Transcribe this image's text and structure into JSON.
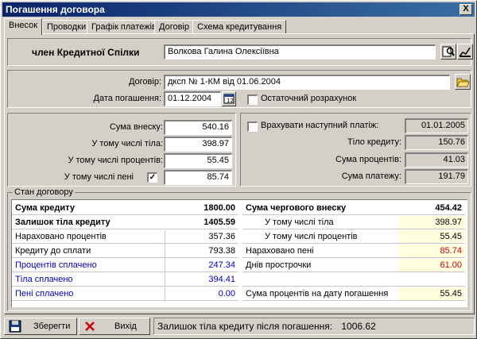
{
  "window": {
    "title": "Погашення договора",
    "close_label": "X"
  },
  "tabs": [
    "Внесок",
    "Проводки",
    "Графік платежів",
    "Договір",
    "Схема кредитування"
  ],
  "member": {
    "label": "член Кредитної Спілки",
    "name": "Волкова Галина Олексіївна"
  },
  "contract": {
    "contract_label": "Договір:",
    "contract_value": "дксп № 1-КМ від 01.06.2004",
    "date_label": "Дата погашення:",
    "date_value": "01.12.2004",
    "final_calc_label": "Остаточний розрахунок"
  },
  "payment": {
    "sum_label": "Сума внеску:",
    "sum_value": "540.16",
    "body_label": "У тому числі тіла:",
    "body_value": "398.97",
    "interest_label": "У тому числі процентів:",
    "interest_value": "55.45",
    "penalty_label": "У тому числі пені",
    "penalty_value": "85.74",
    "penalty_checked": "✓"
  },
  "next_payment": {
    "include_label": "Врахувати наступний платіж:",
    "date_value": "01.01.2005",
    "body_label": "Тіло кредиту:",
    "body_value": "150.76",
    "interest_label": "Сума процентів:",
    "interest_value": "41.03",
    "total_label": "Сума платежу:",
    "total_value": "191.79"
  },
  "state": {
    "title": "Стан договору",
    "left_rows": [
      {
        "label": "Сума кредиту",
        "value": "1800.00"
      },
      {
        "label": "Залишок тіла кредиту",
        "value": "1405.59"
      },
      {
        "label": "Нараховано процентів",
        "value": "357.36"
      },
      {
        "label": "Кредиту до сплати",
        "value": "793.38"
      },
      {
        "label": "Процентів сплачено",
        "value": "247.34"
      },
      {
        "label": "Тіла сплачено",
        "value": "394.41"
      },
      {
        "label": "Пені сплачено",
        "value": "0.00"
      }
    ],
    "right_rows": [
      {
        "label": "Сума чергового внеску",
        "value": "454.42"
      },
      {
        "label": "У тому числі тіла",
        "value": "398.97"
      },
      {
        "label": "У тому числі процентів",
        "value": "55.45"
      },
      {
        "label": "Нараховано пені",
        "value": "85.74"
      },
      {
        "label": "Днів прострочки",
        "value": "61.00"
      },
      {
        "label": "",
        "value": ""
      },
      {
        "label": "Сума процентів на дату погашення",
        "value": "55.45"
      }
    ]
  },
  "footer": {
    "save_label": "Зберегти",
    "exit_label": "Вихід",
    "status_label": "Залишок тіла кредиту після погашення:",
    "status_value": "1006.62"
  }
}
